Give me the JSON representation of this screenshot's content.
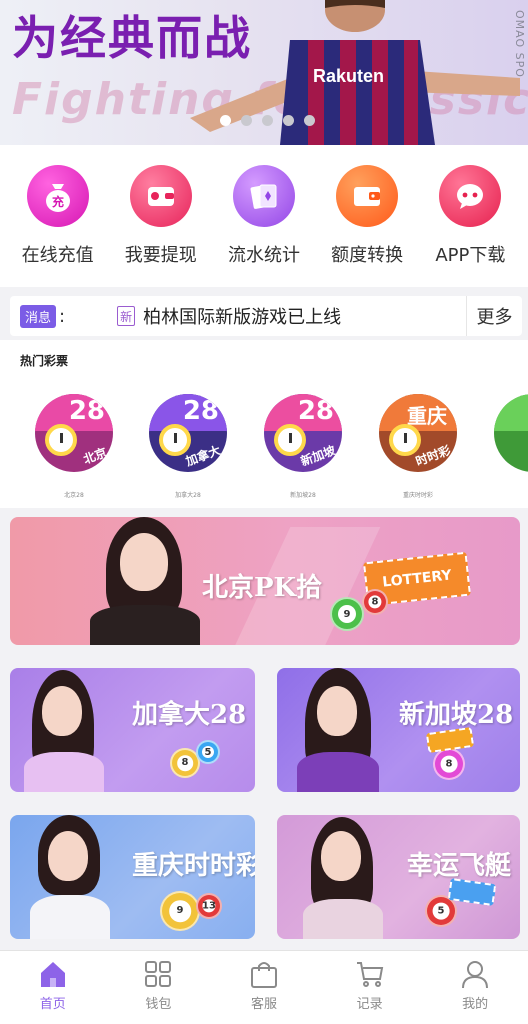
{
  "banner": {
    "title_cn": "为经典而战",
    "title_en": "Fighting for Classics",
    "side_text": "OMAO SPO",
    "jersey_text": "Rakuten",
    "slides": 5,
    "active_slide": 1
  },
  "actions": [
    {
      "label": "在线充值",
      "icon": "money-bag-icon",
      "color": "#e838c8",
      "glyph": "充"
    },
    {
      "label": "我要提现",
      "icon": "wallet-icon",
      "color": "#f24d7a",
      "glyph": ""
    },
    {
      "label": "流水统计",
      "icon": "cards-icon",
      "color": "#b06cf0",
      "glyph": ""
    },
    {
      "label": "额度转换",
      "icon": "transfer-wallet-icon",
      "color": "#ff7a33",
      "glyph": ""
    },
    {
      "label": "APP下载",
      "icon": "chat-app-icon",
      "color": "#f23f6e",
      "glyph": ""
    }
  ],
  "notice": {
    "tag": "消息",
    "colon": ":",
    "new_badge": "新",
    "message": "柏林国际新版游戏已上线",
    "more": "更多"
  },
  "hot": {
    "title": "热门彩票",
    "items": [
      {
        "num": "28",
        "sub": "北京",
        "caption": "北京28",
        "color_top": "#e94aa6",
        "color_bottom": "#a0307e"
      },
      {
        "num": "28",
        "sub": "加拿大",
        "caption": "加拿大28",
        "color_top": "#8a55e8",
        "color_bottom": "#3b2f86"
      },
      {
        "num": "28",
        "sub": "新加坡",
        "caption": "新加坡28",
        "color_top": "#ec4ea0",
        "color_bottom": "#6b3aa8"
      },
      {
        "num": "重庆",
        "sub": "时时彩",
        "caption": "重庆时时彩",
        "color_top": "#f07a3a",
        "color_bottom": "#a24a2a"
      }
    ]
  },
  "cards": {
    "pk10": {
      "title": "北京PK拾",
      "ticket": "LOTTERY"
    },
    "ca28": {
      "title": "加拿大28"
    },
    "sg28": {
      "title": "新加坡28"
    },
    "cqssc": {
      "title": "重庆时时彩"
    },
    "xyft": {
      "title": "幸运飞艇"
    }
  },
  "tabs": [
    {
      "label": "首页",
      "icon": "home-icon",
      "active": true
    },
    {
      "label": "钱包",
      "icon": "grid-icon",
      "active": false
    },
    {
      "label": "客服",
      "icon": "shopping-bag-icon",
      "active": false
    },
    {
      "label": "记录",
      "icon": "cart-icon",
      "active": false
    },
    {
      "label": "我的",
      "icon": "user-icon",
      "active": false
    }
  ],
  "colors": {
    "accent": "#8d63e8",
    "tab_inactive": "#8a8a8a"
  }
}
